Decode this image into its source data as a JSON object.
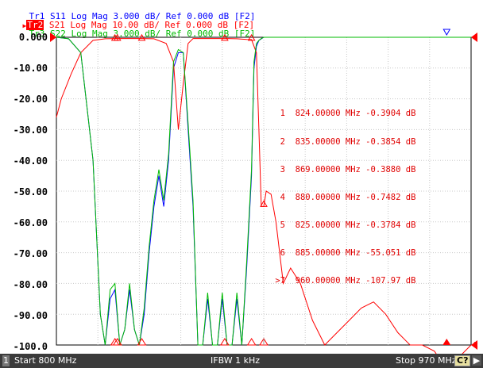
{
  "traces": [
    {
      "id": "Tr1",
      "param": "S11",
      "fmt": "Log Mag",
      "scale": "3.000 dB/",
      "ref": "Ref 0.000 dB",
      "tag": "[F2]",
      "color": "#0000ff"
    },
    {
      "id": "Tr2",
      "param": "S21",
      "fmt": "Log Mag",
      "scale": "10.00 dB/",
      "ref": "Ref 0.000 dB",
      "tag": "[F2]",
      "color": "#ff0000"
    },
    {
      "id": "Tr3",
      "param": "S22",
      "fmt": "Log Mag",
      "scale": "3.000 dB/",
      "ref": "Ref 0.000 dB",
      "tag": "[F2]",
      "color": "#00bb00"
    }
  ],
  "y_axis_labels": [
    "0.000",
    "-10.00",
    "-20.00",
    "-30.00",
    "-40.00",
    "-50.00",
    "-60.00",
    "-70.00",
    "-80.00",
    "-90.00",
    "-100.0"
  ],
  "markers": [
    {
      "num": "1",
      "freq": "824.00000 MHz",
      "value": "-0.3904 dB"
    },
    {
      "num": "2",
      "freq": "835.00000 MHz",
      "value": "-0.3854 dB"
    },
    {
      "num": "3",
      "freq": "869.00000 MHz",
      "value": "-0.3880 dB"
    },
    {
      "num": "4",
      "freq": "880.00000 MHz",
      "value": "-0.7482 dB"
    },
    {
      "num": "5",
      "freq": "825.00000 MHz",
      "value": "-0.3784 dB"
    },
    {
      "num": "6",
      "freq": "885.00000 MHz",
      "value": "-55.051 dB"
    },
    {
      "num": ">7",
      "freq": "960.00000 MHz",
      "value": "-107.97 dB"
    }
  ],
  "status": {
    "channel": "1",
    "start": "Start 800 MHz",
    "ifbw": "IFBW 1 kHz",
    "stop": "Stop 970 MHz",
    "badge": "C?",
    "arrow": "▶"
  },
  "scale_marker_right": "2",
  "chart_data": {
    "type": "line",
    "x_range_mhz": [
      800,
      970
    ],
    "y_range_db_display": [
      -100,
      0
    ],
    "grid": true,
    "series": [
      {
        "name": "Tr1 S11",
        "color": "#0000ff",
        "x": [
          800,
          805,
          810,
          815,
          818,
          820,
          822,
          824,
          826,
          828,
          830,
          832,
          834,
          836,
          838,
          840,
          842,
          844,
          846,
          848,
          850,
          852,
          854,
          856,
          858,
          860,
          862,
          864,
          866,
          868,
          870,
          872,
          874,
          876,
          878,
          880,
          881,
          882,
          883,
          884,
          885,
          890,
          900,
          920,
          940,
          960,
          970
        ],
        "y": [
          0,
          -0.5,
          -5,
          -40,
          -90,
          -100,
          -85,
          -82,
          -100,
          -95,
          -82,
          -95,
          -100,
          -90,
          -70,
          -55,
          -45,
          -55,
          -40,
          -10,
          -5,
          -5,
          -30,
          -55,
          -100,
          -100,
          -85,
          -100,
          -100,
          -85,
          -100,
          -100,
          -85,
          -100,
          -75,
          -45,
          -10,
          -3,
          -1,
          -0.5,
          0,
          0,
          0,
          0,
          0,
          0,
          0
        ]
      },
      {
        "name": "Tr2 S21",
        "color": "#ff0000",
        "x": [
          800,
          802,
          806,
          810,
          815,
          820,
          824,
          826,
          830,
          835,
          840,
          845,
          848,
          850,
          852,
          854,
          856,
          858,
          862,
          866,
          870,
          874,
          878,
          880,
          882,
          883,
          884,
          885,
          886,
          888,
          890,
          893,
          896,
          900,
          905,
          910,
          915,
          920,
          925,
          930,
          935,
          940,
          945,
          950,
          955,
          960,
          965,
          970
        ],
        "y": [
          -26,
          -20,
          -12,
          -5,
          -1,
          -0.5,
          -0.4,
          -0.4,
          -0.4,
          -0.4,
          -0.5,
          -2,
          -8,
          -30,
          -15,
          -2,
          -0.4,
          -0.4,
          -0.4,
          -0.4,
          -0.4,
          -0.5,
          -0.7,
          -0.75,
          -5,
          -30,
          -55,
          -55,
          -50,
          -51,
          -60,
          -80,
          -75,
          -80,
          -92,
          -100,
          -96,
          -92,
          -88,
          -86,
          -90,
          -96,
          -100,
          -100,
          -102,
          -108,
          -104,
          -100
        ]
      },
      {
        "name": "Tr3 S22",
        "color": "#00bb00",
        "x": [
          800,
          805,
          810,
          815,
          818,
          820,
          822,
          824,
          826,
          828,
          830,
          832,
          834,
          836,
          838,
          840,
          842,
          844,
          846,
          848,
          850,
          852,
          854,
          856,
          858,
          860,
          862,
          864,
          866,
          868,
          870,
          872,
          874,
          876,
          878,
          880,
          881,
          882,
          883,
          884,
          885,
          890,
          900,
          920,
          940,
          960,
          970
        ],
        "y": [
          0,
          -0.5,
          -5,
          -40,
          -90,
          -100,
          -82,
          -80,
          -100,
          -95,
          -80,
          -95,
          -100,
          -88,
          -68,
          -53,
          -43,
          -53,
          -38,
          -8,
          -4,
          -5,
          -28,
          -53,
          -100,
          -100,
          -83,
          -100,
          -100,
          -83,
          -100,
          -100,
          -83,
          -100,
          -73,
          -43,
          -8,
          -2,
          -1,
          -0.4,
          0,
          0,
          0,
          0,
          0,
          0,
          0
        ]
      }
    ]
  }
}
